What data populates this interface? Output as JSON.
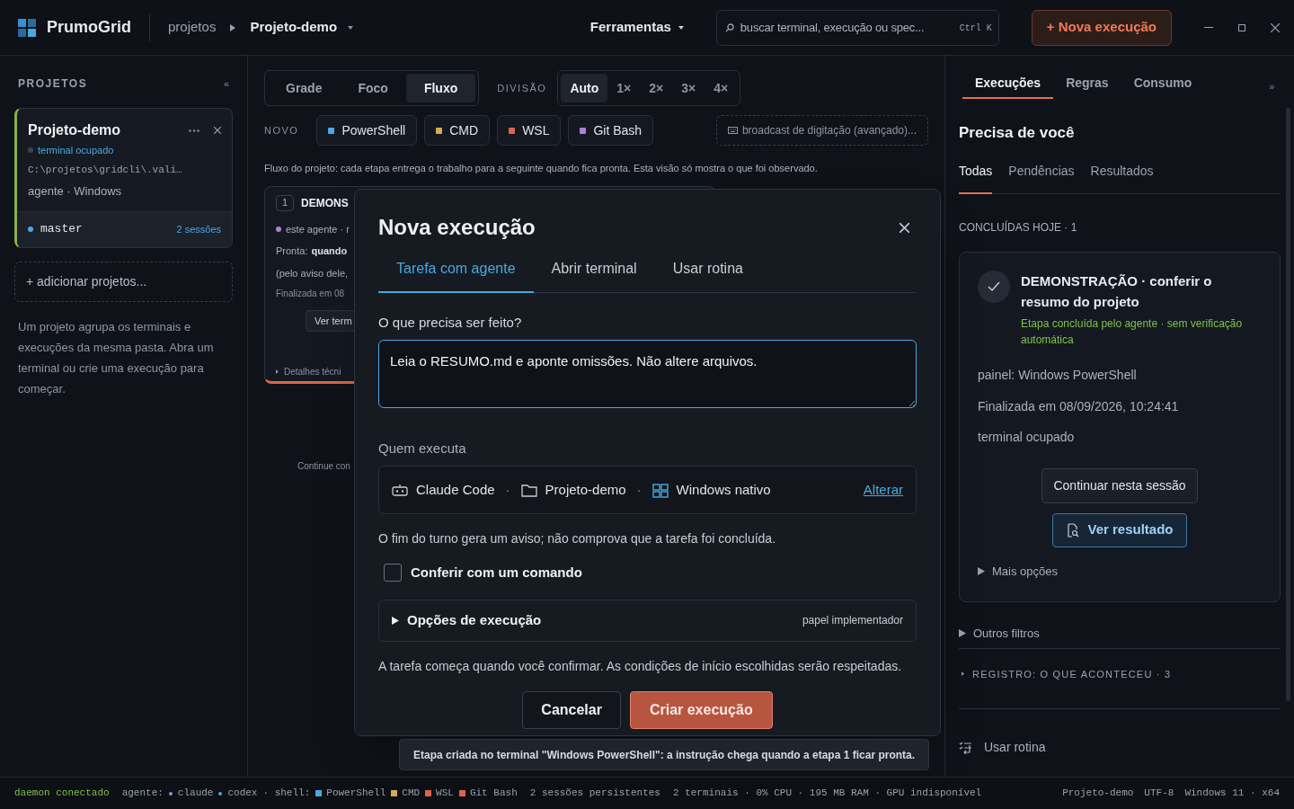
{
  "app": {
    "name": "PrumoGrid"
  },
  "breadcrumb": {
    "root": "projetos",
    "current": "Projeto-demo"
  },
  "tools_menu": {
    "label": "Ferramentas"
  },
  "search": {
    "placeholder": "buscar terminal, execução ou spec...",
    "shortcut": "Ctrl K"
  },
  "new_run_button": {
    "label": "+ Nova execução"
  },
  "sidebar": {
    "title": "PROJETOS",
    "collapse": "«",
    "project": {
      "name": "Projeto-demo",
      "status": "terminal ocupado",
      "path": "C:\\projetos\\gridcli\\.vali…",
      "meta": "agente · Windows",
      "branch": "master",
      "sessions": "2 sessões",
      "selected": true
    },
    "add": "+ adicionar projetos...",
    "help": "Um projeto agrupa os terminais e execuções da mesma pasta. Abra um terminal ou crie uma execução para começar."
  },
  "views": [
    {
      "label": "Grade",
      "selected": false
    },
    {
      "label": "Foco",
      "selected": false
    },
    {
      "label": "Fluxo",
      "selected": true
    }
  ],
  "division": {
    "label": "DIVISÃO",
    "options": [
      {
        "label": "Auto",
        "selected": true
      },
      {
        "label": "1×",
        "selected": false
      },
      {
        "label": "2×",
        "selected": false
      },
      {
        "label": "3×",
        "selected": false
      },
      {
        "label": "4×",
        "selected": false
      }
    ]
  },
  "new_terminal": {
    "label": "NOVO",
    "shells": [
      {
        "name": "PowerShell",
        "color": "#4aa8e0"
      },
      {
        "name": "CMD",
        "color": "#d9a85a"
      },
      {
        "name": "WSL",
        "color": "#d8664e"
      },
      {
        "name": "Git Bash",
        "color": "#b07fd6"
      }
    ]
  },
  "broadcast": {
    "label": "broadcast de digitação (avançado)..."
  },
  "flow_note": "Fluxo do projeto: cada etapa entrega o trabalho para a seguinte quando fica pronta. Esta visão só mostra o que foi observado.",
  "stage_card": {
    "number": "1",
    "title": "DEMONS",
    "agent": "este agente · r",
    "ready_label": "Pronta:",
    "ready_value": "quando",
    "ready_note": "(pelo aviso dele,",
    "finished": "Finalizada em 08",
    "button": "Ver term",
    "details": "Detalhes técni"
  },
  "continue_hint": "Continue con",
  "modal": {
    "title": "Nova execução",
    "tabs": [
      {
        "label": "Tarefa com agente",
        "selected": true
      },
      {
        "label": "Abrir terminal",
        "selected": false
      },
      {
        "label": "Usar rotina",
        "selected": false
      }
    ],
    "task_label": "O que precisa ser feito?",
    "task_value": "Leia o RESUMO.md e aponte omissões. Não altere arquivos.",
    "runner_label": "Quem executa",
    "runner": [
      {
        "kind": "agent",
        "label": "Claude Code"
      },
      {
        "kind": "folder",
        "label": "Projeto-demo"
      },
      {
        "kind": "os",
        "label": "Windows nativo"
      }
    ],
    "runner_separator": "·",
    "change_link": "Alterar",
    "turn_note": "O fim do turno gera um aviso; não comprova que a tarefa foi concluída.",
    "verify": {
      "label": "Conferir com um comando",
      "checked": false
    },
    "options": {
      "label": "Opções de execução",
      "hint": "papel implementador",
      "expanded": false
    },
    "start_note": "A tarefa começa quando você confirmar. As condições de início escolhidas serão respeitadas.",
    "cancel": "Cancelar",
    "submit": "Criar execução"
  },
  "toast": "Etapa criada no terminal \"Windows PowerShell\": a instrução chega quando a etapa 1 ficar pronta.",
  "right_panel": {
    "tabs": [
      {
        "label": "Execuções",
        "selected": true
      },
      {
        "label": "Regras",
        "selected": false
      },
      {
        "label": "Consumo",
        "selected": false
      }
    ],
    "expand": "»",
    "heading": "Precisa de você",
    "filters": [
      {
        "label": "Todas",
        "selected": true
      },
      {
        "label": "Pendências",
        "selected": false
      },
      {
        "label": "Resultados",
        "selected": false
      }
    ],
    "section": "CONCLUÍDAS HOJE · 1",
    "run": {
      "title": "DEMONSTRAÇÃO · conferir o resumo do projeto",
      "status": "Etapa concluída pelo agente · sem verificação automática",
      "panel": "painel: Windows PowerShell",
      "finished": "Finalizada em 08/09/2026, 10:24:41",
      "terminal": "terminal ocupado",
      "continue": "Continuar nesta sessão",
      "result": "Ver resultado",
      "more": "Mais opções"
    },
    "other_filters": "Outros filtros",
    "log": "REGISTRO: O QUE ACONTECEU · 3",
    "routine": "Usar rotina"
  },
  "status_bar": {
    "daemon": "daemon conectado",
    "agents_label": "agente:",
    "agents": [
      {
        "name": "claude",
        "color": "#b07fd6"
      },
      {
        "name": "codex",
        "color": "#4aa8e0"
      }
    ],
    "shell_label": "· shell:",
    "shells": [
      {
        "name": "PowerShell",
        "color": "#4aa8e0"
      },
      {
        "name": "CMD",
        "color": "#d9a85a"
      },
      {
        "name": "WSL",
        "color": "#d8664e"
      },
      {
        "name": "Git Bash",
        "color": "#d8664e"
      }
    ],
    "stats": [
      "2 sessões persistentes",
      "2 terminais · 0% CPU · 195 MB RAM · GPU indisponível"
    ],
    "right": [
      "Projeto-demo",
      "UTF-8",
      "Windows 11 · x64"
    ]
  }
}
